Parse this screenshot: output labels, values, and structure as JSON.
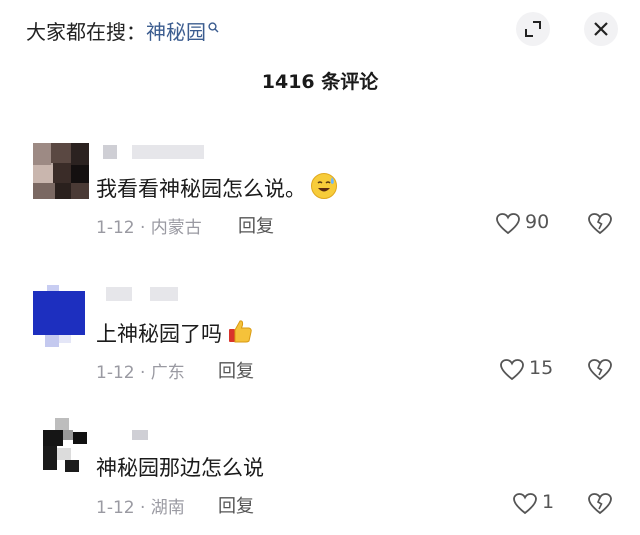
{
  "header": {
    "search_prefix": "大家都在搜：",
    "search_keyword": "神秘园",
    "icons": {
      "search": "search-icon",
      "expand": "expand-icon",
      "close": "close-icon"
    }
  },
  "comment_count": "1416 条评论",
  "comments": [
    {
      "text": "我看看神秘园怎么说。",
      "emoji": "sweat-smile-emoji",
      "date": "1-12 · 内蒙古",
      "reply_label": "回复",
      "likes": "90"
    },
    {
      "text": "上神秘园了吗",
      "emoji": "thumbs-up-emoji",
      "date": "1-12 · 广东",
      "reply_label": "回复",
      "likes": "15"
    },
    {
      "text": "神秘园那边怎么说",
      "date": "1-12 · 湖南",
      "reply_label": "回复",
      "likes": "1"
    }
  ],
  "colors": {
    "keyword": "#3b5c8f",
    "meta": "#9a9aa2",
    "avatar_blue": "#1d2fbf"
  }
}
